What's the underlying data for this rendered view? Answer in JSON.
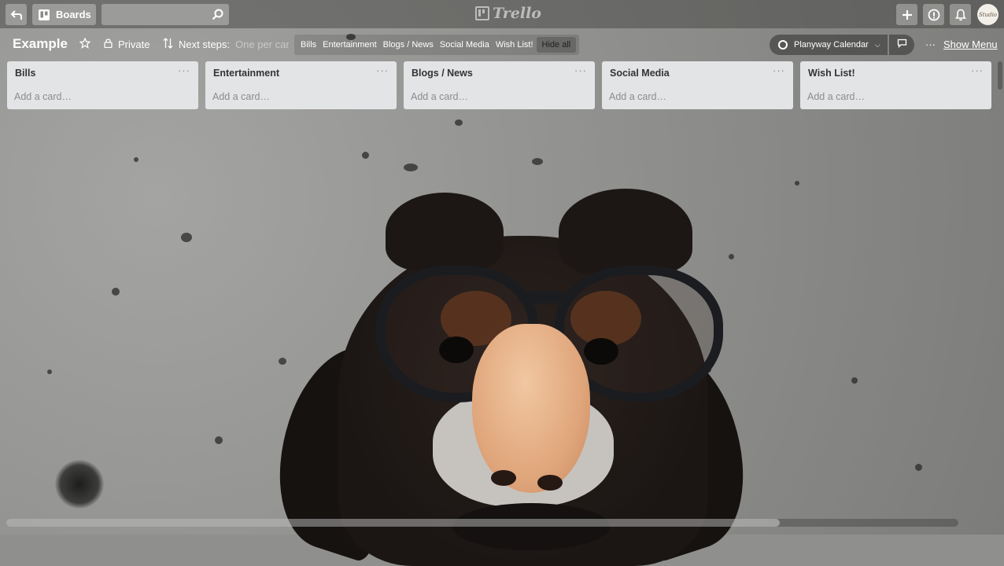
{
  "header": {
    "boards_label": "Boards",
    "search": {
      "value": "",
      "placeholder": ""
    },
    "logo_text": "Trello",
    "avatar_text": "Studio"
  },
  "board": {
    "title": "Example",
    "visibility": "Private",
    "next_steps_label": "Next steps:",
    "next_steps_value": "One per card",
    "filters": [
      "Bills",
      "Entertainment",
      "Blogs / News",
      "Social Media",
      "Wish List!"
    ],
    "hide_all_label": "Hide all",
    "planyway_label": "Planyway Calendar",
    "show_menu_label": "Show Menu"
  },
  "lists": [
    {
      "title": "Bills",
      "add_card": "Add a card…"
    },
    {
      "title": "Entertainment",
      "add_card": "Add a card…"
    },
    {
      "title": "Blogs / News",
      "add_card": "Add a card…"
    },
    {
      "title": "Social Media",
      "add_card": "Add a card…"
    },
    {
      "title": "Wish List!",
      "add_card": "Add a card…"
    }
  ],
  "colors": {
    "header_bg": "#3c3c3a",
    "list_bg": "#e3e4e6",
    "text_dark": "#333333",
    "text_muted": "#8c8c8c"
  },
  "icons": [
    "back-icon",
    "trello-board-icon",
    "search-icon",
    "plus-icon",
    "info-icon",
    "bell-icon",
    "star-icon",
    "lock-icon",
    "sort-icon",
    "chat-icon",
    "chevron-down-icon",
    "more-icon"
  ]
}
